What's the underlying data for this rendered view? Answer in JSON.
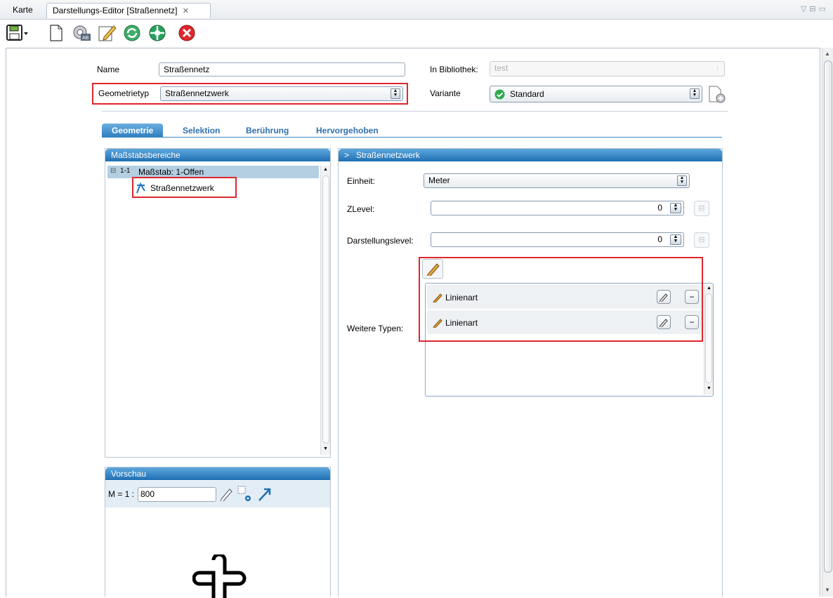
{
  "tabs": {
    "map": "Karte",
    "editor": "Darstellungs-Editor [Straßennetz]"
  },
  "form": {
    "name_label": "Name",
    "name_value": "Straßennetz",
    "library_label": "In Bibliothek:",
    "library_value": "test",
    "geomtype_label": "Geometrietyp",
    "geomtype_value": "Straßennetzwerk",
    "variant_label": "Variante",
    "variant_value": "Standard"
  },
  "inner_tabs": [
    "Geometrie",
    "Selektion",
    "Berührung",
    "Hervorgehoben"
  ],
  "scale_panel": {
    "title": "Maßstabsbereiche",
    "root": "Maßstab: 1-Offen",
    "root_icon_text": "1-1",
    "child": "Straßennetzwerk"
  },
  "detail_panel": {
    "title": "Straßennetzwerk",
    "arrow": ">",
    "unit_label": "Einheit:",
    "unit_value": "Meter",
    "zlevel_label": "ZLevel:",
    "zlevel_value": "0",
    "drawlevel_label": "Darstellungslevel:",
    "drawlevel_value": "0",
    "more_types_label": "Weitere Typen:",
    "types": [
      "Linienart",
      "Linienart"
    ]
  },
  "preview_panel": {
    "title": "Vorschau",
    "scale_prefix": "M = 1 :",
    "scale_value": "800"
  }
}
